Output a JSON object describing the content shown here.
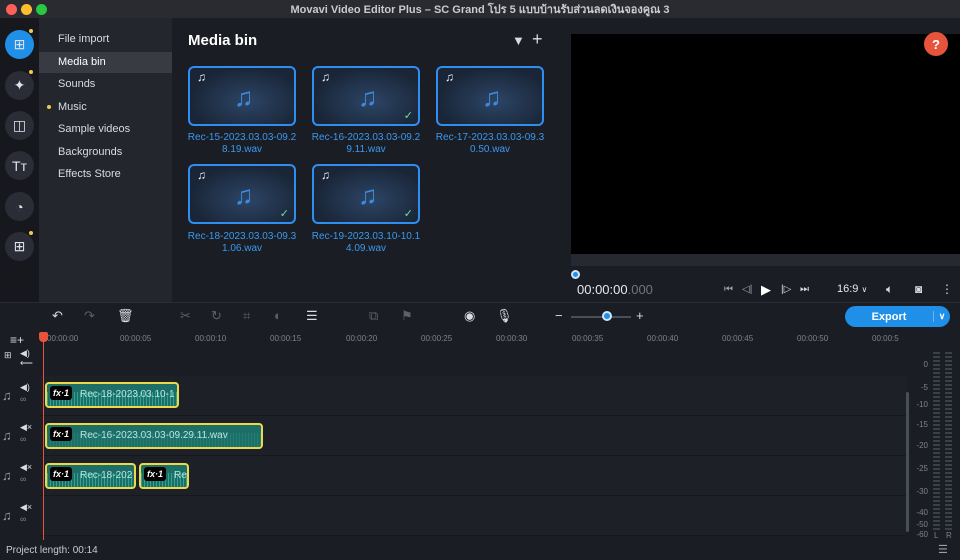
{
  "window": {
    "title": "Movavi Video Editor Plus – SC Grand โปร 5 แบบบ้านรับส่วนลดเงินจองคูณ 3"
  },
  "colors": {
    "accent": "#1f8fe8",
    "clip_border": "#ecd94a",
    "clip_fill": "#1d6e66",
    "playhead": "#e8543b",
    "help": "#e8543b"
  },
  "rail": {
    "items": [
      {
        "icon": "import-icon",
        "glyph": "⊞",
        "active": true
      },
      {
        "icon": "magic-wand-icon",
        "glyph": "✦"
      },
      {
        "icon": "transitions-icon",
        "glyph": "◫"
      },
      {
        "icon": "titles-icon",
        "glyph": "Tт"
      },
      {
        "icon": "stickers-icon",
        "glyph": "◔"
      },
      {
        "icon": "more-tools-icon",
        "glyph": "⊞"
      }
    ]
  },
  "sidemenu": {
    "items": [
      {
        "label": "File import"
      },
      {
        "label": "Media bin",
        "active": true
      },
      {
        "label": "Sounds"
      },
      {
        "label": "Music",
        "dot": true
      },
      {
        "label": "Sample videos"
      },
      {
        "label": "Backgrounds"
      },
      {
        "label": "Effects Store"
      }
    ]
  },
  "mediabin": {
    "title": "Media bin",
    "tiles": [
      {
        "label": "Rec-15-2023.03.03-09.28.19.wav",
        "checked": false
      },
      {
        "label": "Rec-16-2023.03.03-09.29.11.wav",
        "checked": true
      },
      {
        "label": "Rec-17-2023.03.03-09.30.50.wav",
        "checked": false
      },
      {
        "label": "Rec-18-2023.03.03-09.31.06.wav",
        "checked": true
      },
      {
        "label": "Rec-19-2023.03.10-10.14.09.wav",
        "checked": true
      }
    ]
  },
  "preview": {
    "help": "?",
    "timecode_main": "00:00:00",
    "timecode_ms": ".000",
    "aspect": "16:9",
    "aspect_arrow": "∨"
  },
  "toolbar": {
    "export_label": "Export",
    "export_arrow": "∨"
  },
  "timeline": {
    "ticks": [
      "00:00:00",
      "00:00:05",
      "00:00:10",
      "00:00:15",
      "00:00:20",
      "00:00:25",
      "00:00:30",
      "00:00:35",
      "00:00:40",
      "00:00:45",
      "00:00:50",
      "00:00:5"
    ],
    "clips": [
      {
        "name": "Rec-18-2023.03.10-1",
        "fx": "fx·1"
      },
      {
        "name": "Rec-16-2023.03.03-09.29.11.wav",
        "fx": "fx·1"
      },
      {
        "name": "Rec-18-202",
        "fx": "fx·1"
      },
      {
        "name": "Rec",
        "fx": "fx·1"
      }
    ]
  },
  "meter": {
    "db_labels": [
      "0",
      "-5",
      "-10",
      "-15",
      "-20",
      "-25",
      "-30",
      "-40",
      "-50",
      "-60"
    ],
    "channels": [
      "L",
      "R"
    ]
  },
  "footer": {
    "project_length": "Project length: 00:14"
  }
}
